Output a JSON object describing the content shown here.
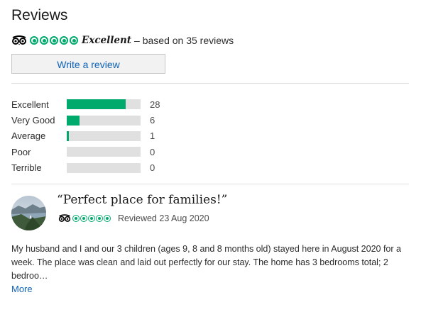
{
  "header": {
    "title": "Reviews"
  },
  "summary": {
    "bubble_rating": 5,
    "bubble_max": 5,
    "rating_word": "Excellent",
    "based_text": "– based on 35 reviews",
    "accent_color": "#00aa6c",
    "icon": "tripadvisor-owl-icon"
  },
  "write_review": {
    "label": "Write a review",
    "color": "#0f62b5"
  },
  "distribution": [
    {
      "label": "Excellent",
      "count": "28",
      "fraction": 0.8
    },
    {
      "label": "Very Good",
      "count": "6",
      "fraction": 0.17
    },
    {
      "label": "Average",
      "count": "1",
      "fraction": 0.03
    },
    {
      "label": "Poor",
      "count": "0",
      "fraction": 0.0
    },
    {
      "label": "Terrible",
      "count": "0",
      "fraction": 0.0
    }
  ],
  "review": {
    "avatar_icon": "lake-landscape-avatar",
    "title": "“Perfect place for families!”",
    "bubble_rating": 5,
    "reviewed": "Reviewed 23 Aug 2020",
    "body": "My husband and I and our 3 children (ages 9, 8 and 8 months old) stayed here in August 2020 for a week. The place was clean and laid out perfectly for our stay. The home has 3 bedrooms total; 2 bedroo…",
    "more_label": "More"
  }
}
